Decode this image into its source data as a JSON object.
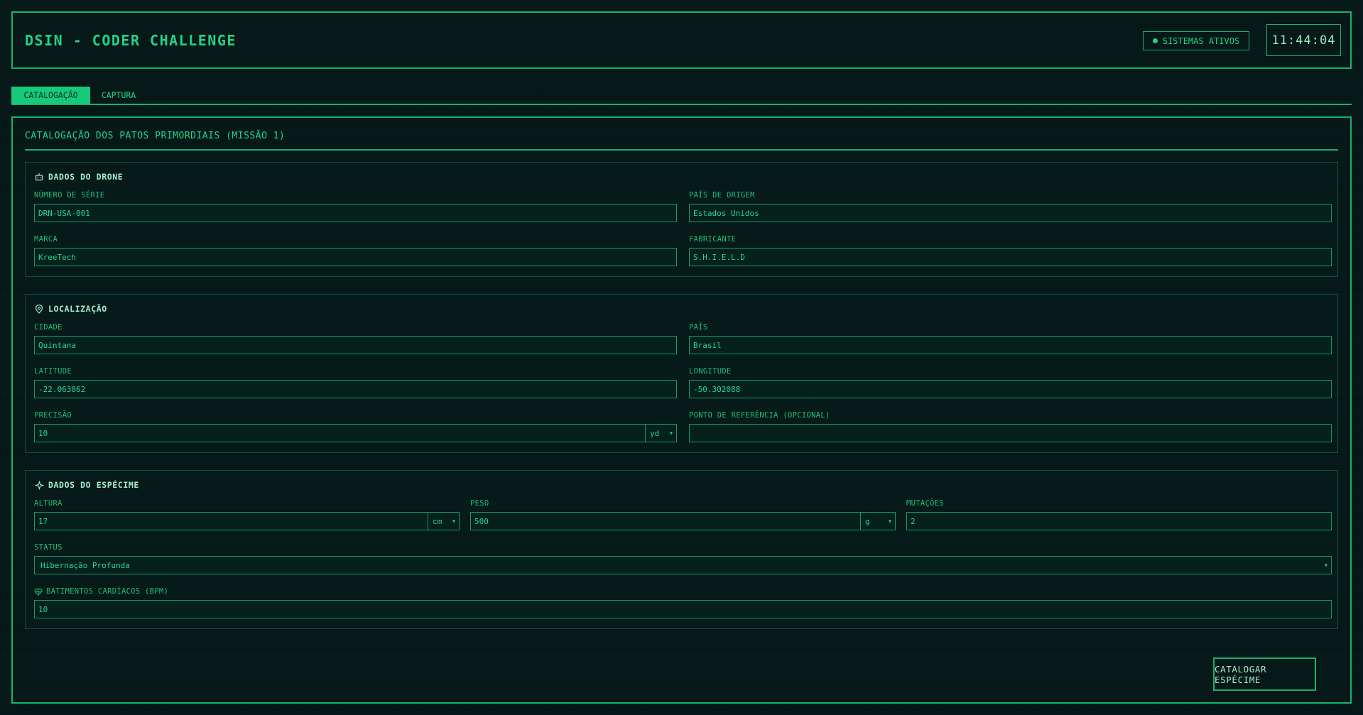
{
  "header": {
    "title": "DSIN - CODER CHALLENGE",
    "status_badge": "SISTEMAS ATIVOS",
    "clock": "11:44:04"
  },
  "tabs": [
    {
      "label": "CATALOGAÇÃO",
      "active": true
    },
    {
      "label": "CAPTURA",
      "active": false
    }
  ],
  "panel": {
    "title": "CATALOGAÇÃO DOS PATOS PRIMORDIAIS (MISSÃO 1)"
  },
  "drone": {
    "heading": "DADOS DO DRONE",
    "serial_label": "NÚMERO DE SÉRIE",
    "serial_value": "DRN-USA-001",
    "origin_label": "PAÍS DE ORIGEM",
    "origin_value": "Estados Unidos",
    "brand_label": "MARCA",
    "brand_value": "KreeTech",
    "maker_label": "FABRICANTE",
    "maker_value": "S.H.I.E.L.D"
  },
  "location": {
    "heading": "LOCALIZAÇÃO",
    "city_label": "CIDADE",
    "city_value": "Quintana",
    "country_label": "PAÍS",
    "country_value": "Brasil",
    "lat_label": "LATITUDE",
    "lat_value": "-22.063062",
    "lon_label": "LONGITUDE",
    "lon_value": "-50.302088",
    "precision_label": "PRECISÃO",
    "precision_value": "10",
    "precision_unit": "yd",
    "reference_label": "PONTO DE REFERÊNCIA (OPCIONAL)",
    "reference_value": ""
  },
  "specimen": {
    "heading": "DADOS DO ESPÉCIME",
    "height_label": "ALTURA",
    "height_value": "17",
    "height_unit": "cm",
    "weight_label": "PESO",
    "weight_value": "500",
    "weight_unit": "g",
    "mutations_label": "MUTAÇÕES",
    "mutations_value": "2",
    "status_label": "STATUS",
    "status_value": "Hibernação Profunda",
    "heartbeat_label": "BATIMENTOS CARDÍACOS (BPM)",
    "heartbeat_value": "10"
  },
  "actions": {
    "catalog_button": "CATALOGAR ESPÉCIME"
  },
  "colors": {
    "accent": "#17c97b",
    "background": "#071a1a"
  }
}
